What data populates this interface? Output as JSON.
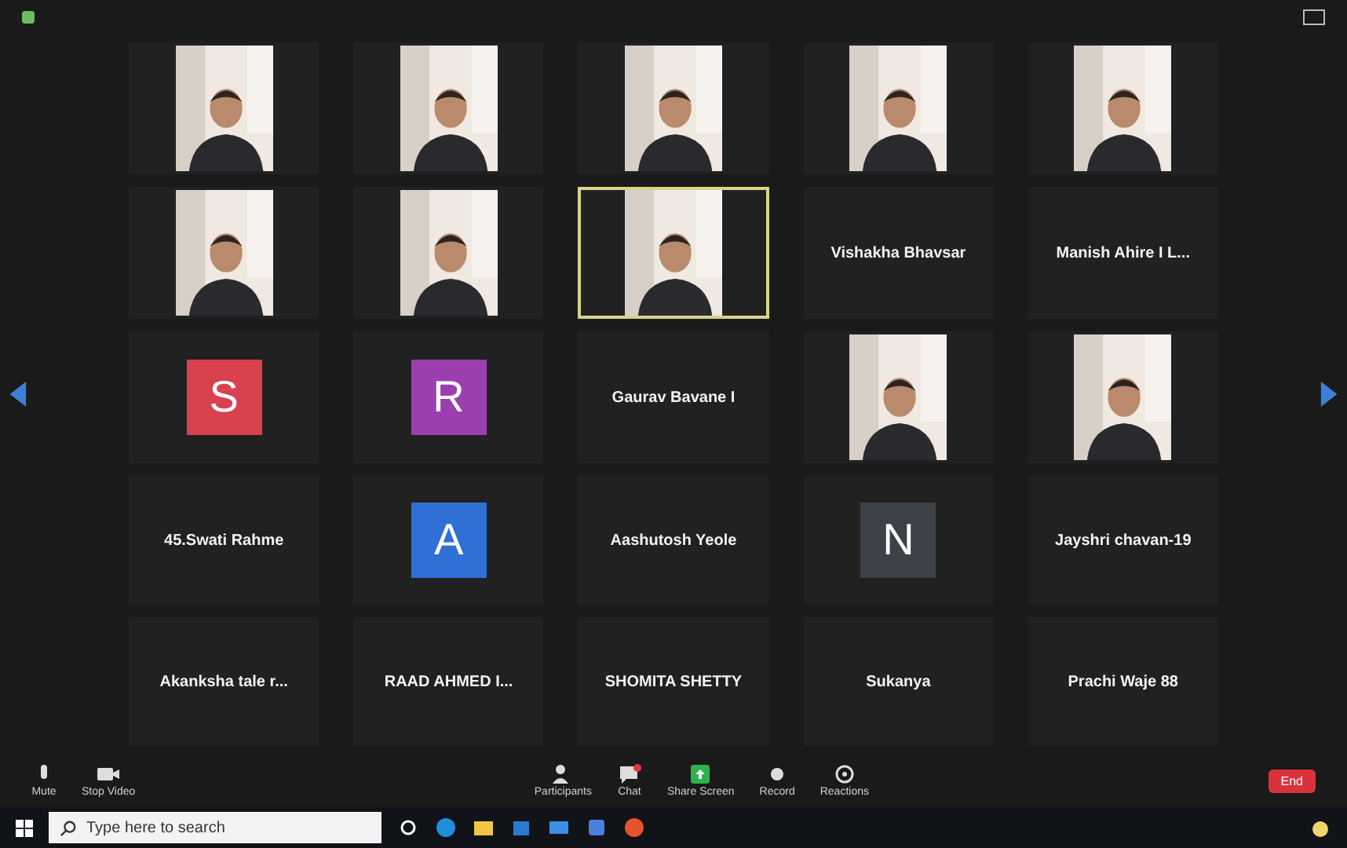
{
  "tiles": [
    {
      "kind": "video",
      "speaking": false
    },
    {
      "kind": "video",
      "speaking": false
    },
    {
      "kind": "video",
      "speaking": false
    },
    {
      "kind": "video",
      "speaking": false
    },
    {
      "kind": "video",
      "speaking": false
    },
    {
      "kind": "video",
      "speaking": false
    },
    {
      "kind": "video",
      "speaking": false
    },
    {
      "kind": "video",
      "speaking": true
    },
    {
      "kind": "name",
      "name": "Vishakha Bhavsar",
      "speaking": false
    },
    {
      "kind": "name",
      "name": "Manish Ahire I L...",
      "speaking": false
    },
    {
      "kind": "avatar",
      "letter": "S",
      "color": "#d9414e",
      "speaking": false
    },
    {
      "kind": "avatar",
      "letter": "R",
      "color": "#9b3fb0",
      "speaking": false
    },
    {
      "kind": "name",
      "name": "Gaurav Bavane I",
      "speaking": false
    },
    {
      "kind": "video",
      "speaking": false
    },
    {
      "kind": "video",
      "speaking": false
    },
    {
      "kind": "name",
      "name": "45.Swati Rahme",
      "speaking": false
    },
    {
      "kind": "avatar",
      "letter": "A",
      "color": "#2f6fd6",
      "speaking": false
    },
    {
      "kind": "name",
      "name": "Aashutosh Yeole",
      "speaking": false
    },
    {
      "kind": "avatar",
      "letter": "N",
      "color": "#3c4147",
      "speaking": false
    },
    {
      "kind": "name",
      "name": "Jayshri chavan-19",
      "speaking": false
    },
    {
      "kind": "name",
      "name": "Akanksha tale r...",
      "speaking": false
    },
    {
      "kind": "name",
      "name": "RAAD AHMED I...",
      "speaking": false
    },
    {
      "kind": "name",
      "name": "SHOMITA SHETTY",
      "speaking": false
    },
    {
      "kind": "name",
      "name": "Sukanya",
      "speaking": false
    },
    {
      "kind": "name",
      "name": "Prachi Waje 88",
      "speaking": false
    }
  ],
  "toolbar": [
    {
      "kind": "mic",
      "label": "Mute"
    },
    {
      "kind": "video",
      "label": "Stop Video"
    },
    {
      "kind": "participants",
      "label": "Participants"
    },
    {
      "kind": "chat",
      "label": "Chat"
    },
    {
      "kind": "share",
      "label": "Share Screen"
    },
    {
      "kind": "record",
      "label": "Record"
    },
    {
      "kind": "reactions",
      "label": "Reactions"
    }
  ],
  "end_button": "End",
  "taskbar": {
    "search": {
      "placeholder": "Type here to search"
    }
  }
}
